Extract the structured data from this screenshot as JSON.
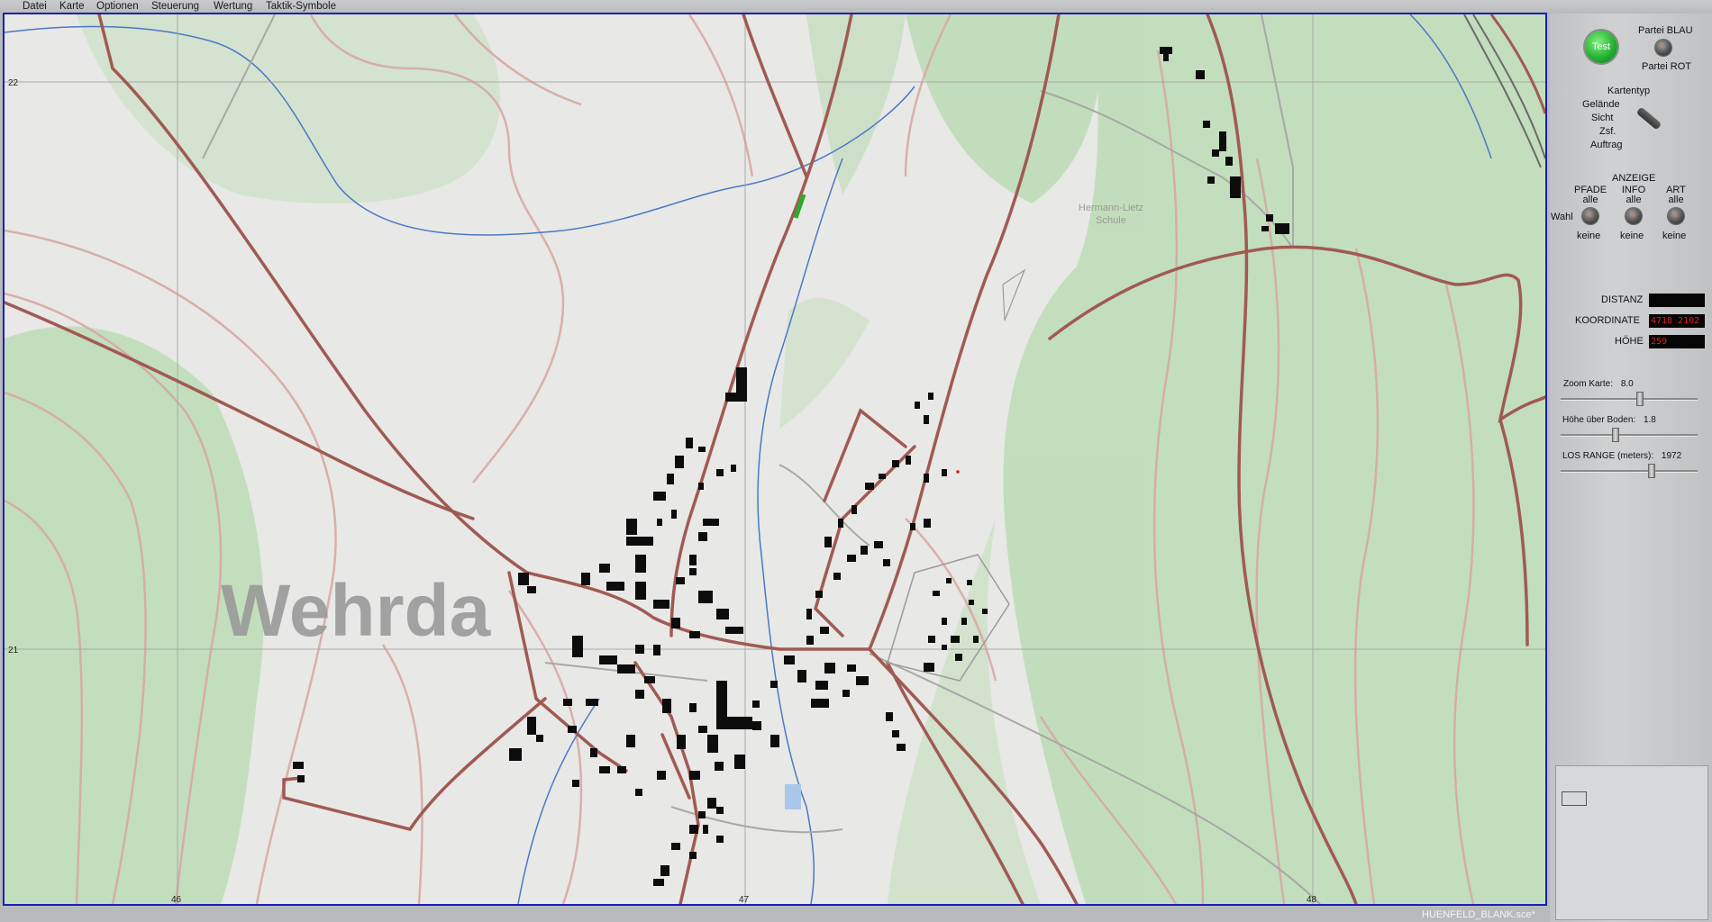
{
  "menu": [
    "Datei",
    "Karte",
    "Optionen",
    "Steuerung",
    "Wertung",
    "Taktik-Symbole"
  ],
  "map": {
    "town_name": "Wehrda",
    "school_line1": "Hermann-Lietz",
    "school_line2": "Schule",
    "grid_labels_left": [
      "22",
      "21"
    ],
    "grid_labels_bottom": [
      "46",
      "47",
      "48"
    ]
  },
  "panel": {
    "test_button": "Test",
    "partei_blau": "Partei BLAU",
    "partei_rot": "Partei ROT",
    "kartentyp": {
      "title": "Kartentyp",
      "options": [
        "Gelände",
        "Sicht",
        "Zsf.",
        "Auftrag"
      ]
    },
    "anzeige": {
      "title": "ANZEIGE",
      "wahl": "Wahl",
      "columns": [
        {
          "name": "PFADE",
          "top": "alle",
          "bottom": "keine"
        },
        {
          "name": "INFO",
          "top": "alle",
          "bottom": "keine"
        },
        {
          "name": "ART",
          "top": "alle",
          "bottom": "keine"
        }
      ]
    },
    "readouts": {
      "distanz_label": "DISTANZ",
      "distanz_value": "",
      "koordinate_label": "KOORDINATE",
      "koordinate_value": "4718 2102",
      "hoehe_label": "HÖHE",
      "hoehe_value": "259"
    },
    "sliders": {
      "zoom_label": "Zoom Karte:",
      "zoom_value": "8.0",
      "hoehe_label": "Höhe über Boden:",
      "hoehe_value": "1.8",
      "los_label": "LOS RANGE (meters):",
      "los_value": "1972"
    }
  },
  "status": {
    "file": "HUENFELD_BLANK.sce*"
  },
  "colors": {
    "map_frame": "#1a20b8",
    "road": "#a05a52",
    "forest": "#b9dcb2",
    "contour": "#d7a8a4",
    "stream": "#4a78c8",
    "readout_text": "#e02020",
    "test_button": "#1fae2f"
  }
}
